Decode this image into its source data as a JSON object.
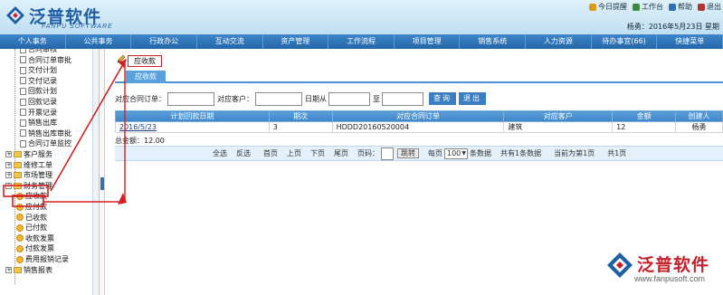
{
  "header": {
    "brand_name": "泛普软件",
    "brand_sub": "FANPU SOFTWARE",
    "toplinks": [
      {
        "label": "今日提醒",
        "icon": "bell-icon",
        "color": "#d79a1a"
      },
      {
        "label": "工作台",
        "icon": "desk-icon",
        "color": "#3a8a3a"
      },
      {
        "label": "帮助",
        "icon": "help-icon",
        "color": "#2f6db5"
      },
      {
        "label": "退出",
        "icon": "exit-icon",
        "color": "#b73333"
      }
    ],
    "user_line": "杨勇：2016年5月23日 星期"
  },
  "menu": [
    "个人事务",
    "公共事务",
    "行政办公",
    "互动交流",
    "资产管理",
    "工作流程",
    "项目管理",
    "销售系统",
    "人力资源",
    "待办事宜(66)",
    "快捷菜单"
  ],
  "sidebar": {
    "items": [
      {
        "label": "合同审核",
        "icon": "doc-icon"
      },
      {
        "label": "合同订单审批",
        "icon": "doc-icon"
      },
      {
        "label": "交付计划",
        "icon": "doc-icon"
      },
      {
        "label": "交付记录",
        "icon": "doc-icon"
      },
      {
        "label": "回款计划",
        "icon": "doc-icon"
      },
      {
        "label": "回款记录",
        "icon": "doc-icon"
      },
      {
        "label": "开票记录",
        "icon": "doc-icon"
      },
      {
        "label": "销售出库",
        "icon": "doc-icon"
      },
      {
        "label": "销售出库审批",
        "icon": "doc-icon"
      },
      {
        "label": "合同订单监控",
        "icon": "doc-icon"
      },
      {
        "label": "客户服务",
        "icon": "folder-icon"
      },
      {
        "label": "维修工单",
        "icon": "folder-icon"
      },
      {
        "label": "市场管理",
        "icon": "folder-icon"
      },
      {
        "label": "财务管理",
        "icon": "folder-icon"
      },
      {
        "label": "应收款",
        "icon": "user-icon"
      },
      {
        "label": "应付款",
        "icon": "user-icon"
      },
      {
        "label": "已收款",
        "icon": "user-icon"
      },
      {
        "label": "已付款",
        "icon": "user-icon"
      },
      {
        "label": "收款发票",
        "icon": "user-icon"
      },
      {
        "label": "付款发票",
        "icon": "user-icon"
      },
      {
        "label": "费用报销记录",
        "icon": "user-icon"
      },
      {
        "label": "销售报表",
        "icon": "folder-icon"
      }
    ]
  },
  "breadcrumb": "应收款",
  "tab": "应收款",
  "filters": {
    "order_label": "对应合同订单：",
    "customer_label": "对应客户：",
    "date_from_label": "日期从",
    "date_to_label": "至",
    "query_button": "查询",
    "exit_button": "退出"
  },
  "table": {
    "headers": [
      "计划回款日期",
      "期次",
      "对应合同订单",
      "对应客户",
      "金额",
      "创建人"
    ],
    "rows": [
      [
        "2016/5/23",
        "3",
        "HDDD20160520004",
        "建筑",
        "12",
        "杨勇"
      ]
    ]
  },
  "total": "总金额：12.00",
  "pager": {
    "select_all": "全选",
    "invert": "反选",
    "first": "首页",
    "prev": "上页",
    "next": "下页",
    "last": "尾页",
    "page_label": "页码：",
    "go_button": "跳转",
    "per_page_label": "每页",
    "per_page_value": "100",
    "per_page_unit": "条数据",
    "total_records": "共有1条数据",
    "current": "当前为第1页",
    "total_pages": "共1页"
  },
  "watermark": {
    "text": "泛普软件",
    "url": "www.fanpusoft.com"
  },
  "colors": {
    "menu_bar": "#2f74ba",
    "accent": "#4a90d0",
    "highlight": "#cc1e1e"
  }
}
